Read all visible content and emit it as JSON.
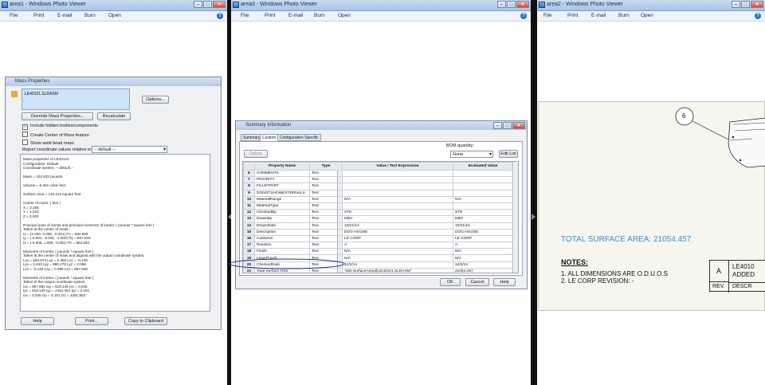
{
  "windows": [
    {
      "title": "area1 - Windows Photo Viewer"
    },
    {
      "title": "area3 - Windows Photo Viewer"
    },
    {
      "title": "area2 - Windows Photo Viewer"
    }
  ],
  "menu": {
    "file": "File",
    "print": "Print",
    "email": "E-mail",
    "burn": "Burn",
    "open": "Open"
  },
  "mass_props": {
    "title": "Mass Properties",
    "file_name": "LE40101.SLDASM",
    "options_btn": "Options...",
    "override_btn": "Override Mass Properties...",
    "recalculate_btn": "Recalculate",
    "include_hidden": "Include hidden bodies/components",
    "create_center": "Create Center of Mass feature",
    "show_weld": "Show weld bead mass",
    "report_label": "Report coordinate values relative to:",
    "report_value": "-- default --",
    "output": [
      "Mass properties of LE40101",
      "     Configuration: Default",
      "     Coordinate system: -- default --",
      "",
      "Mass = 222.933 pounds",
      "",
      "Volume = 8.452 cubic feet",
      "",
      "Surface area = 146.212 square feet",
      "",
      "Center of mass: ( feet )",
      "     X = 2.265",
      "     Y = 1.224",
      "     Z = 0.000",
      "",
      "Principal axes of inertia and principal moments of inertia: ( pounds * square feet )",
      "Taken at the center of mass.",
      "     Ix = (1.000, 0.006, -0.001)          Px = 584.658",
      "     Iy = (-0.001, -0.001, -1.000)         Py = 857.533",
      "     Iz = (-0.006, 1.000, -0.001)          Pz = 963.094",
      "",
      "Moments of inertia: ( pounds * square feet )",
      "Taken at the center of mass and aligned with the output coordinate system.",
      "     Lxx = 584.674        Lxy = 2.486        Lxz = -0.146",
      "     Lyx = 2.463          Lyy = 990.479      Lyz = 0.098",
      "     Lzx = -0.146         Lzy = 0.098        Lzz = 857.539",
      "",
      "Moments of inertia: ( pounds * square feet )",
      "Taken at the output coordinate system.",
      "     Ixx = 957.981        Ixy = 619.145      Ixz = 0.025",
      "     Iyx = 619.145        Iyy = 2151.461     Iyz = 0.191",
      "     Izx = 0.025          Izy = 0.191        Izz = 2281.803"
    ],
    "help_btn": "Help",
    "print_btn": "Print...",
    "copy_btn": "Copy to Clipboard"
  },
  "summary": {
    "title": "Summary Information",
    "tabs": [
      "Summary",
      "Custom",
      "Configuration Specific"
    ],
    "delete_btn": "Delete",
    "bom_label": "BOM quantity:",
    "bom_value": "None",
    "edit_list_btn": "Edit List",
    "columns": [
      "",
      "Property Name",
      "Type",
      "Value / Text Expression",
      "Evaluated Value"
    ],
    "rows": [
      [
        "6",
        "COMMENTS",
        "Text",
        "",
        ""
      ],
      [
        "7",
        "PRIORITY",
        "Text",
        "",
        ""
      ],
      [
        "8",
        "FILLETPART",
        "Text",
        "",
        ""
      ],
      [
        "9",
        "DONOTSHOWEXTERNALS",
        "Text",
        "",
        ""
      ],
      [
        "10",
        "MaterialRange",
        "Text",
        "N/A",
        "N/A"
      ],
      [
        "11",
        "MaterialType",
        "Text",
        "",
        ""
      ],
      [
        "12",
        "CheckedBy",
        "Text",
        "STE",
        "STE"
      ],
      [
        "13",
        "DrawnBy",
        "Text",
        "DBH",
        "DBH"
      ],
      [
        "14",
        "DrawnDate",
        "Text",
        "10/21/14",
        "10/21/14"
      ],
      [
        "15",
        "Description",
        "Text",
        "DOG HOUSE",
        "DOG HOUSE"
      ],
      [
        "16",
        "Customer",
        "Text",
        "LE CORP",
        "LE CORP"
      ],
      [
        "17",
        "Revision",
        "Text",
        "A",
        "A"
      ],
      [
        "18",
        "Finish",
        "Text",
        "N/A",
        "N/A"
      ],
      [
        "19",
        "LaserPunch",
        "Text",
        "N/A",
        "N/A"
      ],
      [
        "20",
        "CheckedDate",
        "Text",
        "12/2/14",
        "12/2/14"
      ],
      [
        "21",
        "Total Surface Area",
        "Text",
        "\"SW-SurfaceArea@LE40101.SLDASM\"",
        "21054.457"
      ],
      [
        "22",
        "<Type a new property>",
        "",
        "",
        ""
      ]
    ],
    "ok_btn": "OK",
    "cancel_btn": "Cancel",
    "help_btn": "Help"
  },
  "drawing": {
    "balloon": "6",
    "total_surface": "TOTAL SURFACE AREA: 21054.457",
    "notes_title": "NOTES:",
    "note1": "1. ALL DIMENSIONS ARE O.D.U.O.S",
    "note2": "2. LE CORP REVISION: -",
    "rev_letter": "A",
    "rev_label": "REV.",
    "rev_text1": "LE4010",
    "rev_text2": "ADDED",
    "rev_text3": "DESCR"
  },
  "colors": {
    "accent_blue": "#3a8fd8",
    "oval": "#1f2f8c"
  }
}
